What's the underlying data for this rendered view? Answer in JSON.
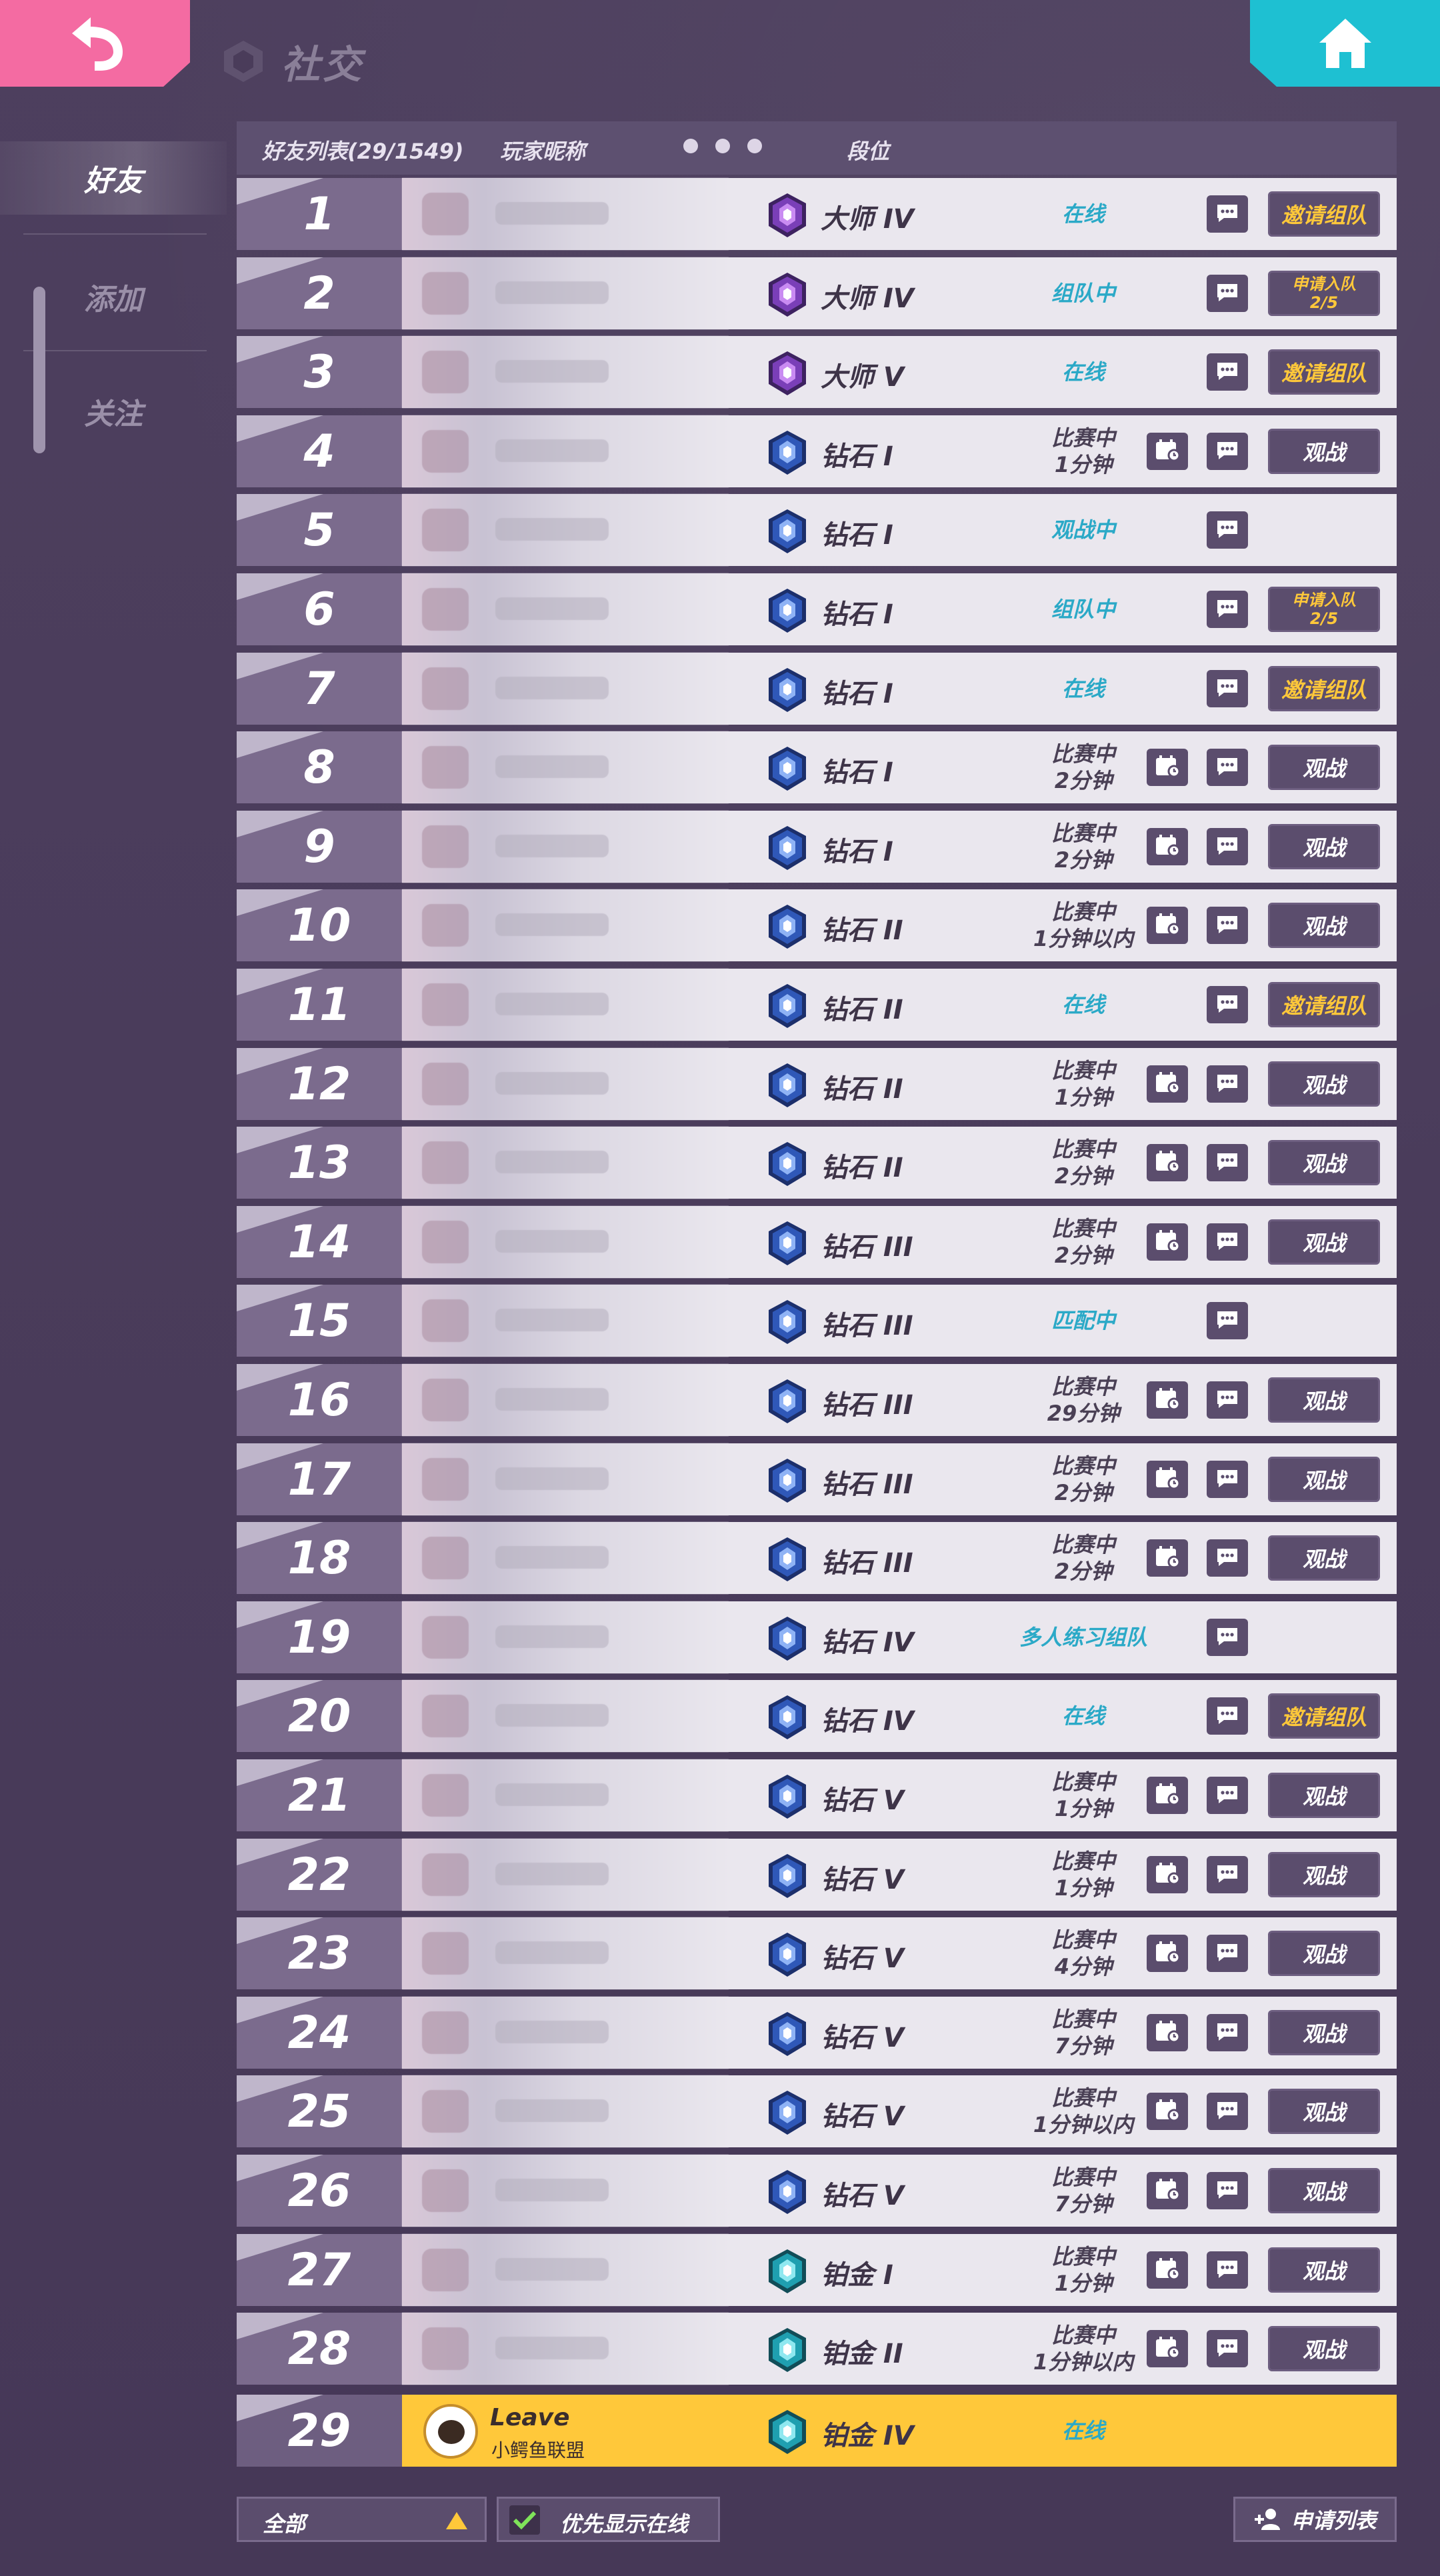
{
  "header": {
    "title": "社交",
    "back_icon": "back-arrow-icon",
    "home_icon": "home-icon",
    "colors": {
      "back": "#f46ba2",
      "home": "#1ec0d2",
      "accent_gold": "#ffc83a",
      "status_cyan": "#2ba9c7"
    }
  },
  "sidebar": {
    "items": [
      {
        "label": "好友",
        "active": true
      },
      {
        "label": "添加",
        "active": false
      },
      {
        "label": "关注",
        "active": false
      }
    ]
  },
  "list_header": {
    "friends_count": "好友列表(29/1549)",
    "nickname": "玩家昵称",
    "rank": "段位"
  },
  "rows": [
    {
      "num": "1",
      "tier": "master",
      "rank": "大师 IV",
      "status": "在线",
      "style": "cyan",
      "spec": false,
      "action": "invite",
      "action_label": "邀请组队"
    },
    {
      "num": "2",
      "tier": "master",
      "rank": "大师 IV",
      "status": "组队中",
      "style": "cyan",
      "spec": false,
      "action": "apply",
      "action_label": "申请入队",
      "action_sub": "2/5"
    },
    {
      "num": "3",
      "tier": "master",
      "rank": "大师 V",
      "status": "在线",
      "style": "cyan",
      "spec": false,
      "action": "invite",
      "action_label": "邀请组队"
    },
    {
      "num": "4",
      "tier": "diamond",
      "rank": "钻石 I",
      "status": "比赛中",
      "status_sub": "1分钟",
      "style": "dark",
      "spec": true,
      "action": "watch",
      "action_label": "观战"
    },
    {
      "num": "5",
      "tier": "diamond",
      "rank": "钻石 I",
      "status": "观战中",
      "style": "cyan",
      "spec": false,
      "action": "none"
    },
    {
      "num": "6",
      "tier": "diamond",
      "rank": "钻石 I",
      "status": "组队中",
      "style": "cyan",
      "spec": false,
      "action": "apply",
      "action_label": "申请入队",
      "action_sub": "2/5"
    },
    {
      "num": "7",
      "tier": "diamond",
      "rank": "钻石 I",
      "status": "在线",
      "style": "cyan",
      "spec": false,
      "action": "invite",
      "action_label": "邀请组队"
    },
    {
      "num": "8",
      "tier": "diamond",
      "rank": "钻石 I",
      "status": "比赛中",
      "status_sub": "2分钟",
      "style": "dark",
      "spec": true,
      "action": "watch",
      "action_label": "观战"
    },
    {
      "num": "9",
      "tier": "diamond",
      "rank": "钻石 I",
      "status": "比赛中",
      "status_sub": "2分钟",
      "style": "dark",
      "spec": true,
      "action": "watch",
      "action_label": "观战"
    },
    {
      "num": "10",
      "tier": "diamond",
      "rank": "钻石 II",
      "status": "比赛中",
      "status_sub": "1分钟以内",
      "style": "dark",
      "spec": true,
      "action": "watch",
      "action_label": "观战"
    },
    {
      "num": "11",
      "tier": "diamond",
      "rank": "钻石 II",
      "status": "在线",
      "style": "cyan",
      "spec": false,
      "action": "invite",
      "action_label": "邀请组队"
    },
    {
      "num": "12",
      "tier": "diamond",
      "rank": "钻石 II",
      "status": "比赛中",
      "status_sub": "1分钟",
      "style": "dark",
      "spec": true,
      "action": "watch",
      "action_label": "观战"
    },
    {
      "num": "13",
      "tier": "diamond",
      "rank": "钻石 II",
      "status": "比赛中",
      "status_sub": "2分钟",
      "style": "dark",
      "spec": true,
      "action": "watch",
      "action_label": "观战"
    },
    {
      "num": "14",
      "tier": "diamond",
      "rank": "钻石 III",
      "status": "比赛中",
      "status_sub": "2分钟",
      "style": "dark",
      "spec": true,
      "action": "watch",
      "action_label": "观战"
    },
    {
      "num": "15",
      "tier": "diamond",
      "rank": "钻石 III",
      "status": "匹配中",
      "style": "cyan",
      "spec": false,
      "action": "none"
    },
    {
      "num": "16",
      "tier": "diamond",
      "rank": "钻石 III",
      "status": "比赛中",
      "status_sub": "29分钟",
      "style": "dark",
      "spec": true,
      "action": "watch",
      "action_label": "观战"
    },
    {
      "num": "17",
      "tier": "diamond",
      "rank": "钻石 III",
      "status": "比赛中",
      "status_sub": "2分钟",
      "style": "dark",
      "spec": true,
      "action": "watch",
      "action_label": "观战"
    },
    {
      "num": "18",
      "tier": "diamond",
      "rank": "钻石 III",
      "status": "比赛中",
      "status_sub": "2分钟",
      "style": "dark",
      "spec": true,
      "action": "watch",
      "action_label": "观战"
    },
    {
      "num": "19",
      "tier": "diamond",
      "rank": "钻石 IV",
      "status": "多人练习组队",
      "style": "cyan",
      "spec": false,
      "action": "none"
    },
    {
      "num": "20",
      "tier": "diamond",
      "rank": "钻石 IV",
      "status": "在线",
      "style": "cyan",
      "spec": false,
      "action": "invite",
      "action_label": "邀请组队"
    },
    {
      "num": "21",
      "tier": "diamond",
      "rank": "钻石 V",
      "status": "比赛中",
      "status_sub": "1分钟",
      "style": "dark",
      "spec": true,
      "action": "watch",
      "action_label": "观战"
    },
    {
      "num": "22",
      "tier": "diamond",
      "rank": "钻石 V",
      "status": "比赛中",
      "status_sub": "1分钟",
      "style": "dark",
      "spec": true,
      "action": "watch",
      "action_label": "观战"
    },
    {
      "num": "23",
      "tier": "diamond",
      "rank": "钻石 V",
      "status": "比赛中",
      "status_sub": "4分钟",
      "style": "dark",
      "spec": true,
      "action": "watch",
      "action_label": "观战"
    },
    {
      "num": "24",
      "tier": "diamond",
      "rank": "钻石 V",
      "status": "比赛中",
      "status_sub": "7分钟",
      "style": "dark",
      "spec": true,
      "action": "watch",
      "action_label": "观战"
    },
    {
      "num": "25",
      "tier": "diamond",
      "rank": "钻石 V",
      "status": "比赛中",
      "status_sub": "1分钟以内",
      "style": "dark",
      "spec": true,
      "action": "watch",
      "action_label": "观战"
    },
    {
      "num": "26",
      "tier": "diamond",
      "rank": "钻石 V",
      "status": "比赛中",
      "status_sub": "7分钟",
      "style": "dark",
      "spec": true,
      "action": "watch",
      "action_label": "观战"
    },
    {
      "num": "27",
      "tier": "platinum",
      "rank": "铂金 I",
      "status": "比赛中",
      "status_sub": "1分钟",
      "style": "dark",
      "spec": true,
      "action": "watch",
      "action_label": "观战"
    },
    {
      "num": "28",
      "tier": "platinum",
      "rank": "铂金 II",
      "status": "比赛中",
      "status_sub": "1分钟以内",
      "style": "dark",
      "spec": true,
      "action": "watch",
      "action_label": "观战"
    }
  ],
  "self_row": {
    "num": "29",
    "name": "Leave",
    "club": "小鳄鱼联盟",
    "tier": "platinum",
    "rank": "铂金 IV",
    "status": "在线"
  },
  "footer": {
    "filter": "全部",
    "online_first": "优先显示在线",
    "apply_list": "申请列表"
  }
}
